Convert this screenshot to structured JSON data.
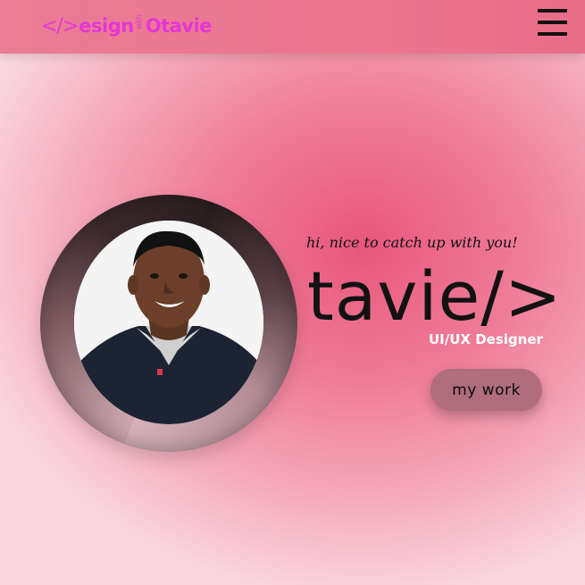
{
  "header": {
    "logo": {
      "code_glyph": "</>",
      "part1": "esign",
      "with_word": "with",
      "part2": "Otavie"
    },
    "menu_icon": "hamburger-menu-icon"
  },
  "hero": {
    "greeting": "hi, nice to catch up with you!",
    "brand": "tavie/>",
    "role": "UI/UX Designer",
    "cta_label": "my work",
    "profile_photo": "profile-photo"
  },
  "colors": {
    "logo": "#e536d6",
    "header": "#ec7590",
    "button": "#b06d7e",
    "role_text": "#ffffff",
    "accent_background": "#e8577c"
  }
}
